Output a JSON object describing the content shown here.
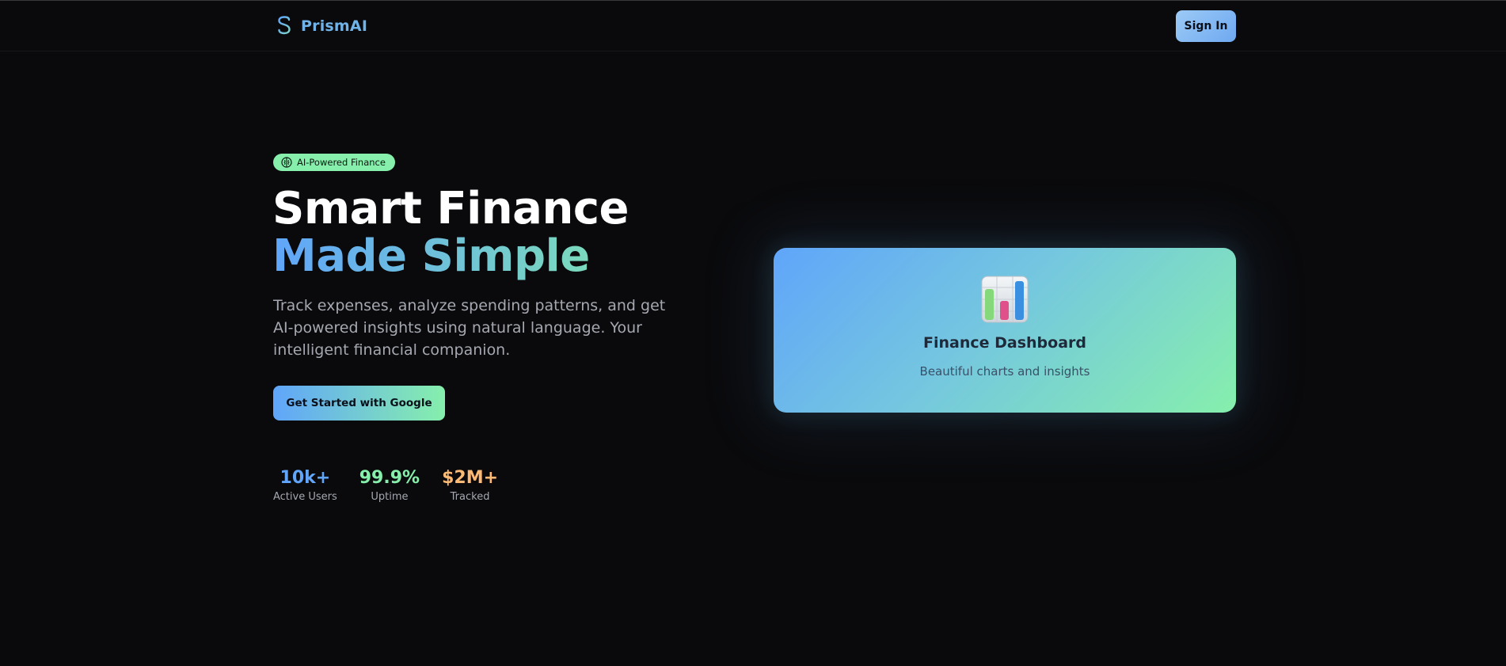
{
  "header": {
    "brand": "PrismAI",
    "sign_in_label": "Sign In"
  },
  "hero": {
    "badge": "AI-Powered Finance",
    "title_line1": "Smart Finance",
    "title_line2": "Made Simple",
    "description": "Track expenses, analyze spending patterns, and get AI-powered insights using natural language. Your intelligent financial companion.",
    "cta_label": "Get Started with Google"
  },
  "stats": [
    {
      "value": "10k+",
      "label": "Active Users",
      "color": "#60a5fa"
    },
    {
      "value": "99.9%",
      "label": "Uptime",
      "color": "#86efac"
    },
    {
      "value": "$2M+",
      "label": "Tracked",
      "color": "#fdba74"
    }
  ],
  "card": {
    "title": "Finance Dashboard",
    "subtitle": "Beautiful charts and insights",
    "icon": "bar-chart-icon"
  },
  "colors": {
    "background": "#0a0a0c",
    "brand": "#6fb3e8",
    "accent_blue": "#60a5fa",
    "accent_green": "#86efac",
    "accent_orange": "#fdba74"
  }
}
